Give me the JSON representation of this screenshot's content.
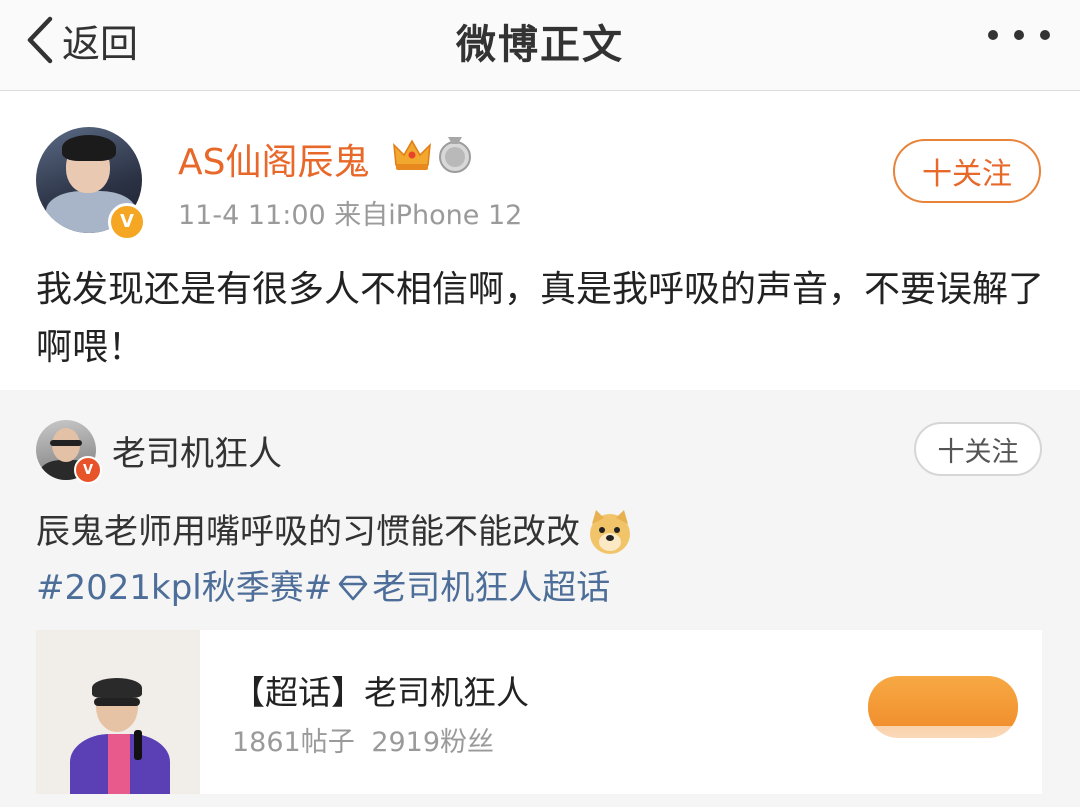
{
  "navbar": {
    "back_label": "返回",
    "title": "微博正文"
  },
  "post": {
    "author": "AS仙阁辰鬼",
    "meta": "11-4 11:00  来自iPhone 12",
    "follow_label": "十关注",
    "text": "我发现还是有很多人不相信啊，真是我呼吸的声音，不要误解了啊喂！"
  },
  "repost": {
    "author": "老司机狂人",
    "follow_label": "十关注",
    "text": "辰鬼老师用嘴呼吸的习惯能不能改改",
    "topic_1": "#2021kpl秋季赛#",
    "topic_2": "老司机狂人超话",
    "card": {
      "title": "【超话】老司机狂人",
      "posts": "1861帖子",
      "fans": "2919粉丝"
    }
  },
  "colors": {
    "accent_orange": "#e8682a",
    "verified_gold": "#f5a623",
    "topic_blue": "#4d6e99",
    "repost_bg": "#f5f5f5"
  },
  "icons": {
    "back": "chevron-left-icon",
    "more": "more-dots-icon",
    "crown": "crown-icon",
    "medal": "medal-icon",
    "verified": "verified-v-icon",
    "emoji": "doge-emoji-icon",
    "supertopic": "diamond-icon"
  }
}
